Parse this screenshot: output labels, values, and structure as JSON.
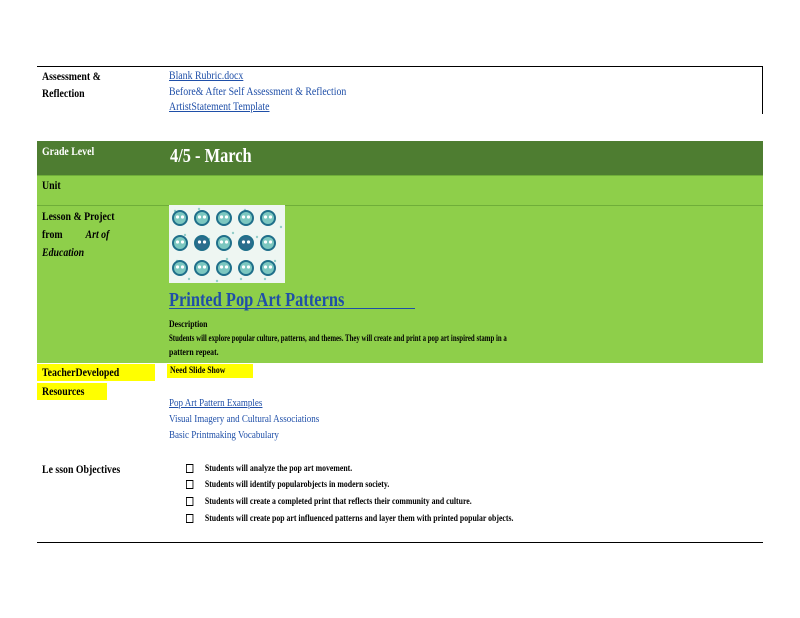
{
  "assessment": {
    "label_line1": "Assessment         &",
    "label_line2": "Reflection",
    "links": [
      "Blank  Rubric.docx",
      "Before&    After   Self  Assessment      & Reflection",
      "ArtistStatement       Template"
    ]
  },
  "grade": {
    "label": "Grade     Level",
    "value": "4/5    - March"
  },
  "unit": {
    "label": "Unit"
  },
  "lesson": {
    "label_line1": "Lesson      & Project",
    "label_line2_a": "from",
    "label_line2_b": "Art    of",
    "label_line3": "Education",
    "project_title": "Printed        Pop     Art    Patterns",
    "description_heading": "Description",
    "description_line1": "Students       will    explore     popular       culture,      patterns,         and    themes.      They      will    create       and    print    a pop   art   inspired      stamp      in   a",
    "description_line2": "pattern     repeat."
  },
  "teacher_resources": {
    "label_line1": "TeacherDeveloped",
    "label_line2": "Resources",
    "need": "Need       Slide      Show",
    "links": [
      "Pop     Art    Pattern       Examples",
      "Visual      Imagery        and     Cultural       Associations",
      "Basic     Printmaking               Vocabulary"
    ]
  },
  "objectives": {
    "label": "Le  sson      Objectives",
    "items": [
      "Students         will    analyze          the    pop    art     movement.",
      "Students         will    identify          popularobjects                in   modern        society.",
      "Students         will    create       a  completed            print      that    reflects          their      community             and    culture.",
      "Students         will    create        pop     art   influenced           patterns           and     layer       them       with       printed          popular          objects."
    ]
  },
  "colors": {
    "grade_row": "#4e7d31",
    "green_rows": "#8ecf4a",
    "highlight": "#ffff00",
    "link": "#1f4fa8"
  },
  "thumbnail_icon": "skull-pattern-image"
}
